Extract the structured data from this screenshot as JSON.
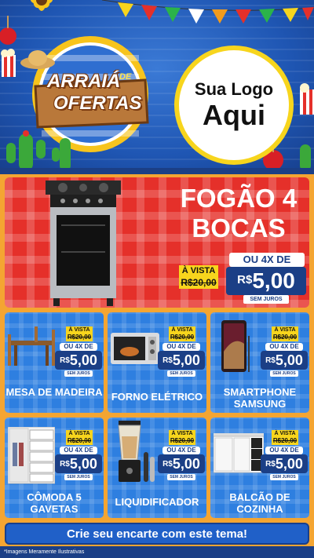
{
  "header": {
    "badge_line1": "ARRAIÁ",
    "badge_de": "DE",
    "badge_line2": "OFERTAS",
    "logo_line1": "Sua Logo",
    "logo_line2": "Aqui"
  },
  "hero": {
    "title": "FOGÃO 4 BOCAS",
    "vista_label": "À VISTA",
    "old_price": "R$20,00",
    "installments_label": "OU 4X DE",
    "currency": "R$",
    "price": "5,00",
    "juros": "SEM JUROS"
  },
  "products": [
    {
      "name": "MESA DE MADEIRA",
      "vista_label": "À VISTA",
      "old_price": "R$20,00",
      "installments_label": "OU 4X DE",
      "currency": "R$",
      "price": "5,00",
      "juros": "SEM JUROS"
    },
    {
      "name": "FORNO ELÉTRICO",
      "vista_label": "À VISTA",
      "old_price": "R$20,00",
      "installments_label": "OU 4X DE",
      "currency": "R$",
      "price": "5,00",
      "juros": "SEM JUROS"
    },
    {
      "name": "SMARTPHONE SAMSUNG",
      "vista_label": "À VISTA",
      "old_price": "R$20,00",
      "installments_label": "OU 4X DE",
      "currency": "R$",
      "price": "5,00",
      "juros": "SEM JUROS"
    },
    {
      "name": "CÔMODA 5 GAVETAS",
      "vista_label": "À VISTA",
      "old_price": "R$20,00",
      "installments_label": "OU 4X DE",
      "currency": "R$",
      "price": "5,00",
      "juros": "SEM JUROS"
    },
    {
      "name": "LIQUIDIFICADOR",
      "vista_label": "À VISTA",
      "old_price": "R$20,00",
      "installments_label": "OU 4X DE",
      "currency": "R$",
      "price": "5,00",
      "juros": "SEM JUROS"
    },
    {
      "name": "BALCÃO DE COZINHA",
      "vista_label": "À VISTA",
      "old_price": "R$20,00",
      "installments_label": "OU 4X DE",
      "currency": "R$",
      "price": "5,00",
      "juros": "SEM JUROS"
    }
  ],
  "cta": {
    "label": "Crie seu encarte com este tema!"
  },
  "footnote": "*Imagens Meramente Ilustrativas",
  "colors": {
    "red": "#e5302a",
    "blue": "#2e7fe0",
    "navy": "#1b3f86",
    "yellow": "#f7d51d",
    "orange": "#f4a532"
  }
}
